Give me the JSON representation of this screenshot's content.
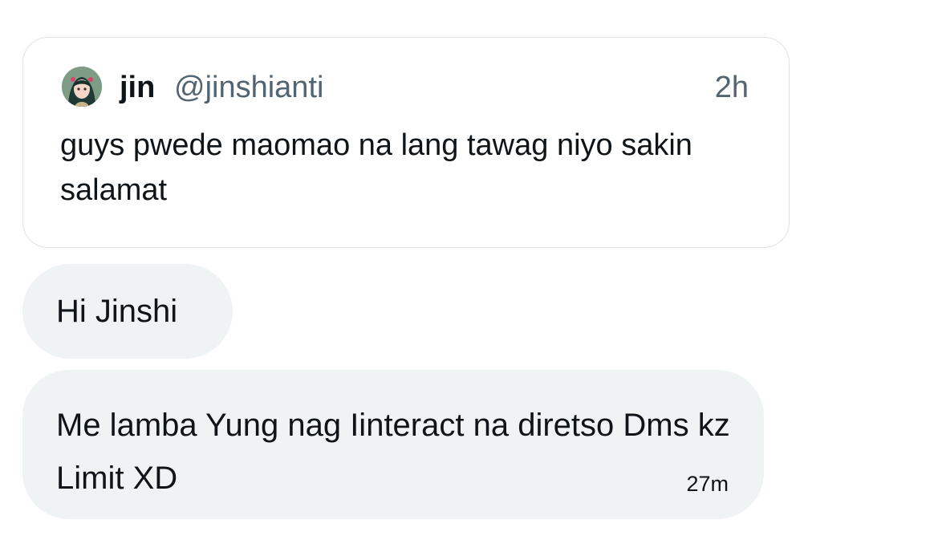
{
  "quoted_post": {
    "author_name": "jin",
    "author_handle": "@jinshianti",
    "time": "2h",
    "text": "guys pwede maomao na lang tawag niyo sakin salamat",
    "avatar_icon": "anime-avatar-icon"
  },
  "messages": [
    {
      "text": "Hi Jinshi",
      "time": ""
    },
    {
      "text": "Me lamba Yung nag Iinteract na diretso Dms kz Limit XD",
      "time": "27m"
    }
  ],
  "colors": {
    "bubble_bg": "#eff3f4",
    "card_border": "#dfe3e6",
    "secondary_text": "#536471",
    "primary_text": "#0f1419"
  }
}
